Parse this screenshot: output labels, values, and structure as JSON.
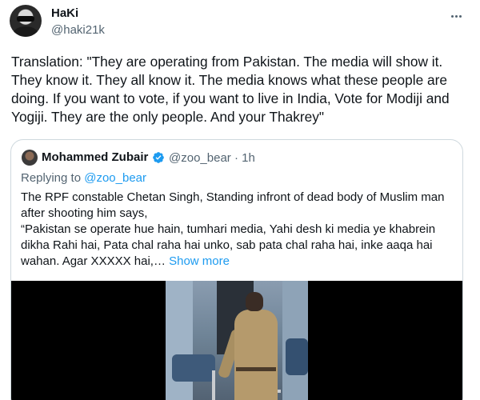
{
  "tweet": {
    "author_name": "HaKi",
    "author_handle": "@haki21k",
    "text": "Translation: \"They are operating from Pakistan. The media will show it. They know it. They all know it. The media knows what these people are doing. If you want to vote, if you want to live in India, Vote for Modiji and Yogiji. They are the only people. And your Thakrey\""
  },
  "quote": {
    "author_name": "Mohammed Zubair",
    "verified": true,
    "handle": "@zoo_bear",
    "separator": "·",
    "time": "1h",
    "replying_prefix": "Replying to ",
    "replying_to": "@zoo_bear",
    "text_line1": "The RPF constable Chetan Singh, Standing infront of dead body of Muslim man after shooting him says,",
    "text_line2": "“Pakistan se operate hue hain, tumhari media, Yahi desh ki media ye khabrein dikha Rahi hai, Pata chal raha hai unko, sab pata chal raha hai, inke aaqa hai wahan. Agar XXXXX hai,…",
    "show_more": "Show more"
  },
  "colors": {
    "link": "#1d9bf0",
    "secondary_text": "#536471",
    "border": "#cfd9de"
  }
}
